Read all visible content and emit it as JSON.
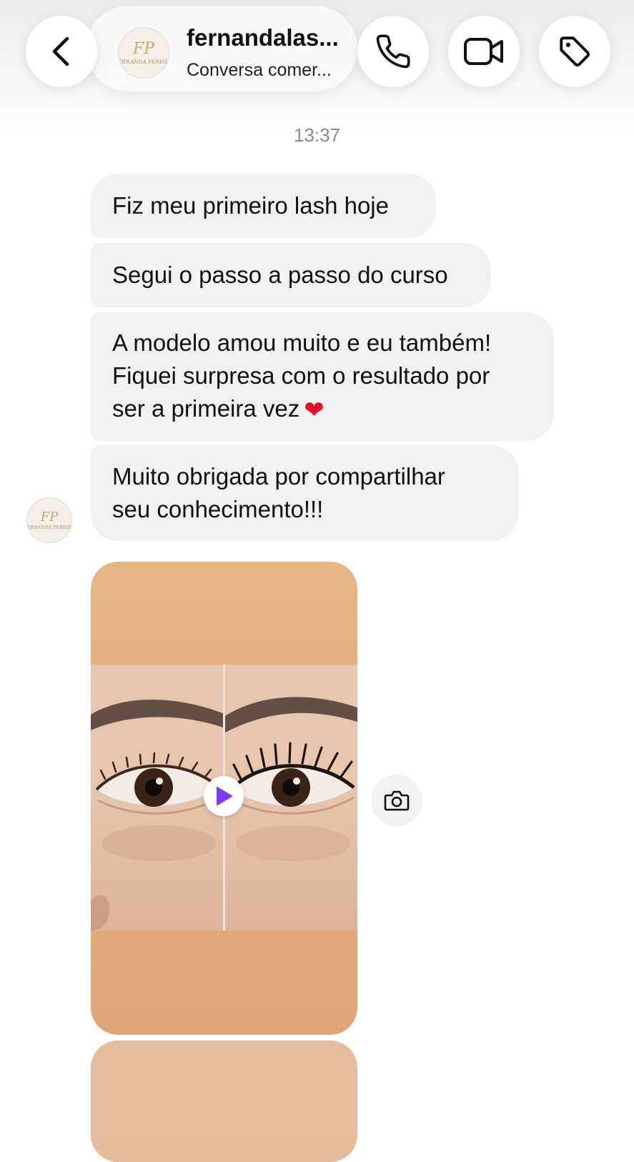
{
  "header": {
    "username": "fernandalas...",
    "subtitle": "Conversa comer...",
    "avatar_monogram": "FP",
    "avatar_brand": "FERNANDA PEREIRA"
  },
  "thread": {
    "timestamp": "13:37",
    "messages": [
      {
        "lines": [
          "Fiz meu primeiro lash hoje"
        ]
      },
      {
        "lines": [
          "Segui o passo a passo do curso"
        ]
      },
      {
        "lines": [
          "A modelo amou muito e eu também!",
          "Fiquei surpresa com o resultado por",
          "ser a primeira vez"
        ],
        "emoji": "❤"
      },
      {
        "lines": [
          "Muito obrigada por compartilhar",
          "seu conhecimento!!!"
        ]
      }
    ]
  },
  "icons": {
    "back": "chevron-left-icon",
    "call": "phone-icon",
    "video": "video-camera-icon",
    "tag": "tag-icon",
    "play": "play-icon",
    "camera": "camera-icon"
  },
  "colors": {
    "bubble": "#f0f1f3",
    "play_accent": "#7b3ff2",
    "heart": "#e0102a"
  }
}
